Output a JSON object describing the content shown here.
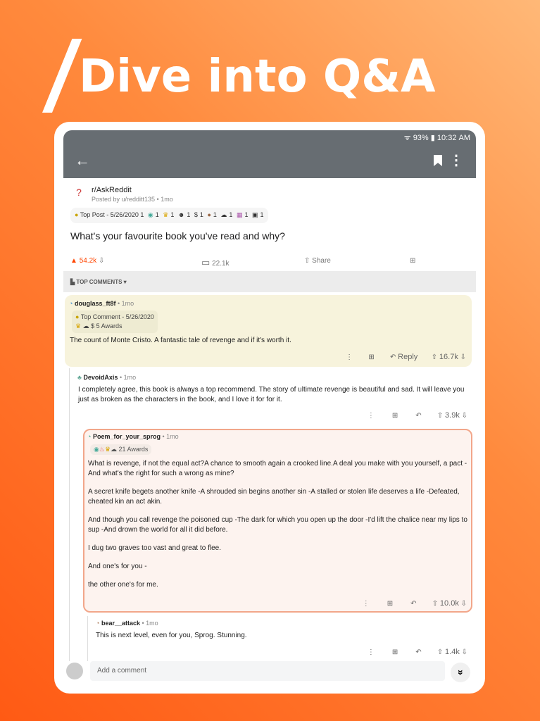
{
  "headline": "Dive into Q&A",
  "status": {
    "signal": "93%",
    "time": "10:32 AM"
  },
  "post": {
    "subreddit": "r/AskReddit",
    "posted_by": "Posted by u/redditt135 • 1mo",
    "award_label": "Top Post - 5/26/2020",
    "award_counts": [
      "1",
      "1",
      "1",
      "1",
      "1",
      "1",
      "1",
      "1",
      "1"
    ],
    "title": "What's your favourite book you've read and why?",
    "upvotes": "54.2k",
    "comments": "22.1k",
    "share": "Share"
  },
  "sort_label": "TOP COMMENTS",
  "comments": [
    {
      "user": "douglass_ft8f",
      "age": "• 1mo",
      "award_label": "Top Comment - 5/26/2020",
      "awards": "5 Awards",
      "body": "The count of Monte Cristo. A fantastic tale of revenge and if it's worth it.",
      "reply": "Reply",
      "score": "16.7k"
    },
    {
      "user": "DevoidAxis",
      "age": "• 1mo",
      "body": "I completely agree, this book is always a top recommend.  The story of ultimate revenge is beautiful and sad. It will leave you just as broken as the characters in the book, and I love it for for it.",
      "score": "3.9k"
    },
    {
      "user": "Poem_for_your_sprog",
      "age": "• 1mo",
      "awards": "21 Awards",
      "paragraphs": [
        "What is revenge, if not the equal act?A chance to smooth again a crooked line.A deal you make with you yourself, a pact -And what's the right for such a wrong as mine?",
        "A secret knife begets another knife -A shrouded sin begins another sin -A stalled or stolen life deserves a life -Defeated, cheated kin an act akin.",
        "And though you call revenge the poisoned cup -The dark for which you open up the door -I'd lift the chalice near my lips to sup -And drown the world for all it did before.",
        "I dug two graves too vast and great to flee.",
        "And one's for you -",
        "the other one's for me."
      ],
      "score": "10.0k"
    },
    {
      "user": "bear__attack",
      "age": "• 1mo",
      "body": "This is next level, even for you, Sprog. Stunning.",
      "score": "1.4k"
    }
  ],
  "add_comment_placeholder": "Add a comment",
  "colors": {
    "accent": "#ff4500",
    "appbar": "#676d72",
    "highlight": "#f7f3dc",
    "sprog_border": "#f2a68a"
  }
}
